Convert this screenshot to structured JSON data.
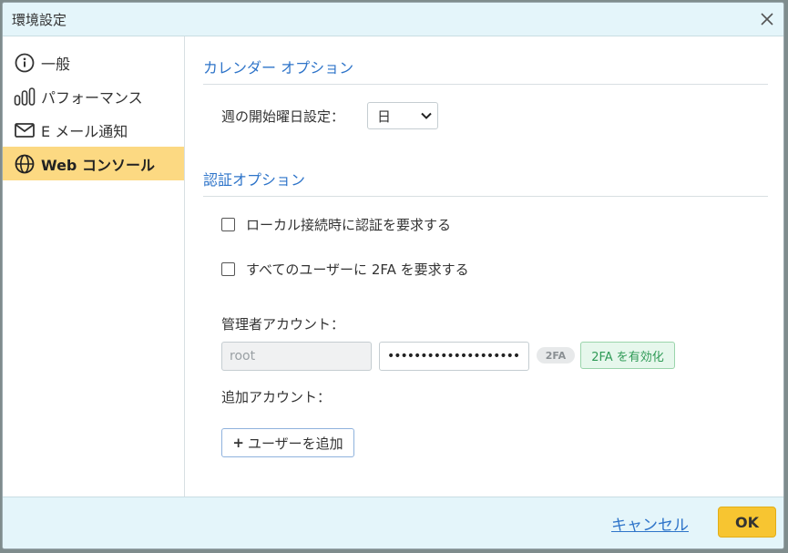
{
  "window": {
    "title": "環境設定"
  },
  "sidebar": {
    "items": [
      {
        "label": "一般",
        "icon": "info-circle-icon"
      },
      {
        "label": "パフォーマンス",
        "icon": "bar-chart-icon"
      },
      {
        "label": "E メール通知",
        "icon": "envelope-icon"
      },
      {
        "label": "Web コンソール",
        "icon": "globe-icon",
        "active": true
      }
    ]
  },
  "calendar": {
    "section_title": "カレンダー オプション",
    "week_start_label": "週の開始曜日設定：",
    "week_start_value": "日"
  },
  "auth": {
    "section_title": "認証オプション",
    "require_local_auth": {
      "label": "ローカル接続時に認証を要求する",
      "checked": false
    },
    "require_2fa_all": {
      "label": "すべてのユーザーに 2FA を要求する",
      "checked": false
    },
    "admin_label": "管理者アカウント：",
    "admin_username_placeholder": "root",
    "admin_password_mask": "••••••••••••••••••••",
    "badge_2fa": "2FA",
    "enable_2fa_label": "2FA を有効化",
    "additional_label": "追加アカウント：",
    "add_user_plus": "+",
    "add_user_label": "ユーザーを追加"
  },
  "footer": {
    "cancel_label": "キャンセル",
    "ok_label": "OK"
  },
  "colors": {
    "accent_blue": "#2e74c9",
    "active_item_bg": "#fcd982",
    "ok_button": "#f7c531",
    "titlebar_bg": "#e4f5fa",
    "enable_2fa_green": "#2f9a56"
  }
}
